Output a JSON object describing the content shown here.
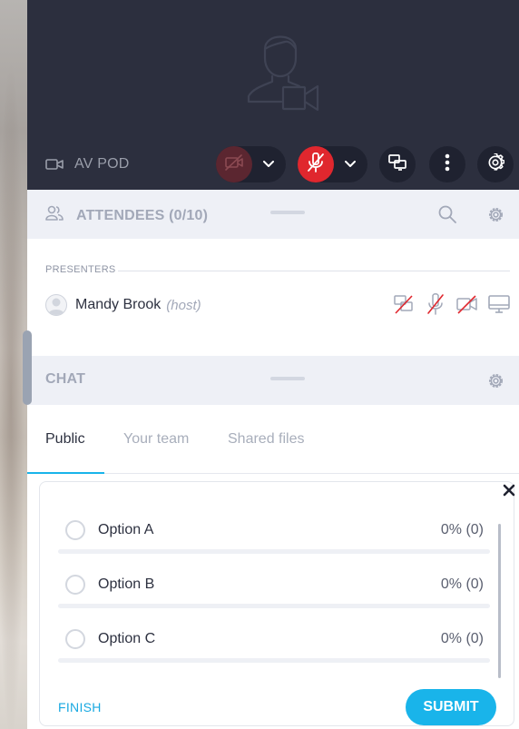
{
  "av_pod": {
    "label": "AV POD",
    "camera_icon": "video-camera-icon",
    "placeholder_icon": "user-with-camera-icon",
    "camera_toggle": {
      "icon": "video-off-icon",
      "state": "off"
    },
    "mic_toggle": {
      "icon": "mic-off-icon",
      "state": "off"
    },
    "share_icon": "screen-share-icon",
    "more_icon": "more-vertical-icon",
    "settings_icon": "gear-icon",
    "colors": {
      "background": "#2c2f3e",
      "danger": "#e0272e"
    }
  },
  "attendees": {
    "title": "ATTENDEES (0/10)",
    "search_icon": "search-icon",
    "settings_icon": "gear-icon",
    "presenters_label": "PRESENTERS",
    "presenters": [
      {
        "name": "Mandy Brook",
        "role": "(host)",
        "status_icons": [
          "screen-share-off-icon",
          "mic-off-icon",
          "video-off-icon",
          "monitor-icon"
        ]
      }
    ]
  },
  "chat": {
    "title": "CHAT",
    "settings_icon": "gear-icon",
    "tabs": [
      {
        "label": "Public",
        "active": true
      },
      {
        "label": "Your team",
        "active": false
      },
      {
        "label": "Shared files",
        "active": false
      }
    ]
  },
  "poll": {
    "close_icon": "close-icon",
    "options": [
      {
        "label": "Option A",
        "result": "0% (0)",
        "fraction": 0
      },
      {
        "label": "Option B",
        "result": "0% (0)",
        "fraction": 0
      },
      {
        "label": "Option C",
        "result": "0% (0)",
        "fraction": 0
      }
    ],
    "finish_label": "FINISH",
    "submit_label": "SUBMIT",
    "accent_color": "#19b4ea"
  }
}
